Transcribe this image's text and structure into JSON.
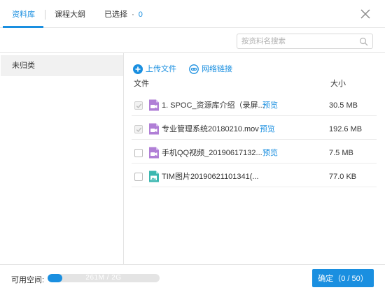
{
  "tabs": {
    "library": "资料库",
    "syllabus": "课程大纲",
    "selected_label": "已选择",
    "selected_dot": "·",
    "selected_count": "0"
  },
  "search": {
    "placeholder": "按资料名搜索"
  },
  "sidebar": {
    "items": [
      {
        "label": "未归类"
      }
    ]
  },
  "actions": {
    "upload": "上传文件",
    "link": "网络链接"
  },
  "columns": {
    "file": "文件",
    "size": "大小"
  },
  "files": [
    {
      "name": "1. SPOC_资源库介绍（录屏...",
      "preview": "预览",
      "size": "30.5 MB",
      "type": "video",
      "checked": true
    },
    {
      "name": "专业管理系统20180210.mov",
      "preview": "预览",
      "size": "192.6 MB",
      "type": "video",
      "checked": true
    },
    {
      "name": "手机QQ视频_2019061713​2...",
      "preview": "预览",
      "size": "7.5 MB",
      "type": "video",
      "checked": false
    },
    {
      "name": "TIM图片20190621101341(...",
      "preview": "",
      "size": "77.0 KB",
      "type": "image",
      "checked": false
    }
  ],
  "footer": {
    "space_label": "可用空间:",
    "space_text": "261M / 2G",
    "space_used_fraction": 0.13,
    "confirm": "确定（0 / 50）"
  },
  "colors": {
    "accent": "#1a8fe0",
    "video_icon": "#b07fd6",
    "image_icon": "#3bb7b0"
  }
}
